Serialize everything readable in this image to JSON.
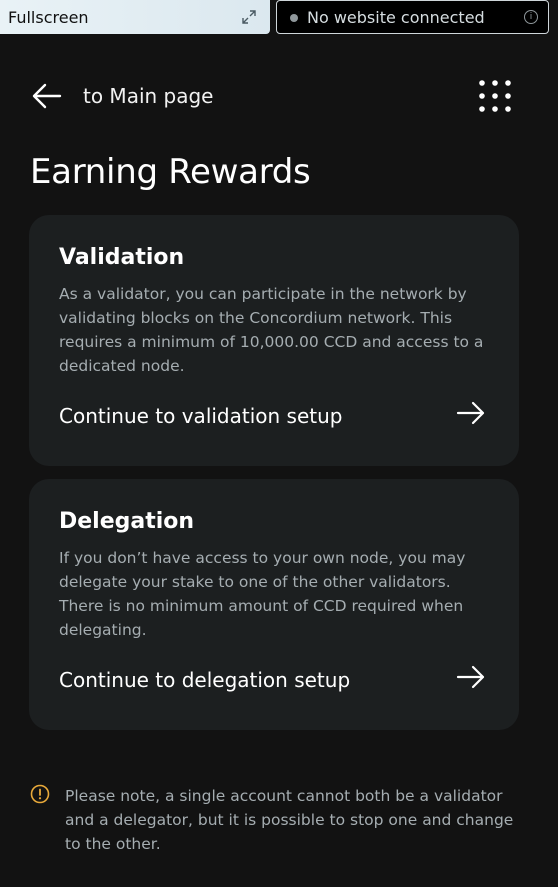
{
  "topbar": {
    "fullscreen_label": "Fullscreen",
    "connection_status": "No website connected",
    "info_icon": "i"
  },
  "header": {
    "back_label": "to Main page",
    "title": "Earning Rewards"
  },
  "cards": [
    {
      "title": "Validation",
      "description": "As a validator, you can participate in the network by validating blocks on the Concordium network. This requires a minimum of 10,000.00 CCD and access to a dedicated node.",
      "link": "Continue to validation setup"
    },
    {
      "title": "Delegation",
      "description": "If you don’t have access to your own node, you may delegate your stake to one of the other validators. There is no minimum amount of CCD required when delegating.",
      "link": "Continue to delegation setup"
    }
  ],
  "note": {
    "text": "Please note, a single account cannot both be a validator and a delegator, but it is possible to stop one and change to the other."
  },
  "colors": {
    "background": "#121212",
    "card": "#1c1f20",
    "muted_text": "#a5adb1",
    "warning": "#e8a93a"
  },
  "icons": {
    "fullscreen": "expand-arrows-icon",
    "status": "dot-icon",
    "info": "info-icon",
    "back": "arrow-left-icon",
    "menu": "grid-dots-icon",
    "card_arrow": "arrow-right-icon",
    "note": "warning-circle-icon"
  }
}
